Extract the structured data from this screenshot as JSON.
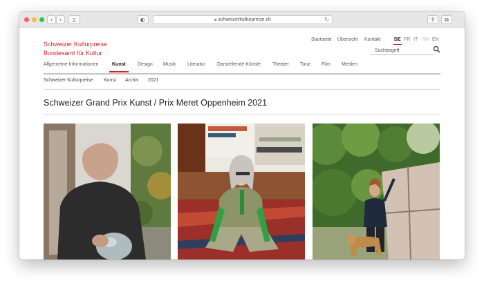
{
  "browser": {
    "url": "schweizerkulturpreise.ch",
    "colors": {
      "close": "#fe5f57",
      "minimize": "#febc2e",
      "zoom": "#28c840"
    }
  },
  "site": {
    "brand_line1": "Schweizer Kulturpreise",
    "brand_line2": "Bundesamt für Kultur",
    "brand_color": "#d41f26",
    "top_links": [
      "Startseite",
      "Übersicht",
      "Kontakt"
    ],
    "languages": [
      "DE",
      "FR",
      "IT",
      "RM",
      "EN"
    ],
    "active_language": "DE",
    "search_placeholder": "Suchbegriff",
    "main_nav": [
      "Allgemeine Informationen",
      "Kunst",
      "Design",
      "Musik",
      "Literatur",
      "Darstellende Künste",
      "Theater",
      "Tanz",
      "Film",
      "Medien"
    ],
    "active_nav": "Kunst",
    "breadcrumb": [
      "Schweizer Kulturpreise",
      "Kunst",
      "Archiv",
      "2021"
    ],
    "page_title": "Schweizer Grand Prix Kunst / Prix Meret Oppenheim 2021"
  },
  "photos": [
    {
      "subject": "elderly man in dark sweater holding a stone sculpture",
      "icon": "portrait-photo"
    },
    {
      "subject": "woman in green outfit seated on a patterned rug in a studio",
      "icon": "portrait-photo"
    },
    {
      "subject": "woman with a dog standing in a garden beside a translucent panel",
      "icon": "portrait-photo"
    }
  ]
}
